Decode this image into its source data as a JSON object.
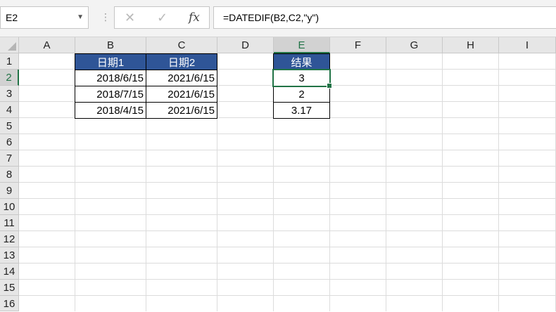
{
  "formula_bar": {
    "name_box": "E2",
    "formula": "=DATEDIF(B2,C2,\"y\")",
    "cancel_icon": "✕",
    "enter_icon": "✓",
    "fx_label": "fx"
  },
  "columns": [
    "A",
    "B",
    "C",
    "D",
    "E",
    "F",
    "G",
    "H",
    "I"
  ],
  "rows": [
    "1",
    "2",
    "3",
    "4",
    "5",
    "6",
    "7",
    "8",
    "9",
    "10",
    "11",
    "12",
    "13",
    "14",
    "15",
    "16"
  ],
  "table": {
    "headers": [
      "日期1",
      "日期2"
    ],
    "rows": [
      [
        "2018/6/15",
        "2021/6/15"
      ],
      [
        "2018/7/15",
        "2021/6/15"
      ],
      [
        "2018/4/15",
        "2021/6/15"
      ]
    ]
  },
  "result": {
    "header": "结果",
    "values": [
      "3",
      "2",
      "3.17"
    ]
  },
  "selected_cell": "E2",
  "colors": {
    "header_fill": "#2f5597",
    "selection": "#217346"
  }
}
